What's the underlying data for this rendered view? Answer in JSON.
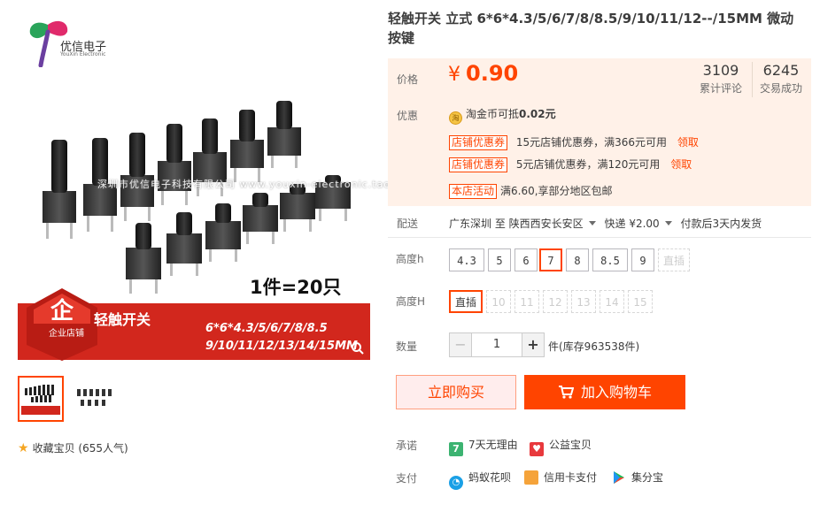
{
  "store": {
    "logo_text": "优信电子",
    "logo_sub": "YouXin Electronic"
  },
  "gallery": {
    "watermark": "深圳市优信电子科技有限公司  www.youxin-electronic.taobao.com",
    "qty_label": "1件=20只",
    "banner": {
      "badge_label": "企业店铺",
      "title": "轻触开关",
      "specs_line1": "6*6*4.3/5/6/7/8/8.5",
      "specs_line2": "9/10/11/12/13/14/15MM"
    },
    "thumbs": [
      "thumb-1",
      "thumb-2"
    ],
    "favorite": "收藏宝贝",
    "favorite_count": "(655人气)"
  },
  "product": {
    "title": "轻触开关 立式 6*6*4.3/5/6/7/8/8.5/9/10/11/12--/15MM 微动 按键",
    "price_label": "价格",
    "currency": "¥",
    "price": "0.90",
    "reviews_count": "3109",
    "reviews_label": "累计评论",
    "sales_count": "6245",
    "sales_label": "交易成功",
    "promo_label": "优惠",
    "coin_text": "淘金币可抵",
    "coin_value": "0.02元",
    "coupons": [
      {
        "tag": "店铺优惠券",
        "text": "15元店铺优惠券，满366元可用",
        "link": "领取"
      },
      {
        "tag": "店铺优惠券",
        "text": "5元店铺优惠券，满120元可用",
        "link": "领取"
      }
    ],
    "activity_tag": "本店活动",
    "activity_text": "满6.60,享部分地区包邮",
    "ship_label": "配送",
    "ship_from": "广东深圳 至",
    "ship_to": "陕西西安长安区",
    "ship_method": "快递 ¥2.00",
    "ship_time": "付款后3天内发货",
    "height_h_label": "高度h",
    "height_h_options": [
      "4.3",
      "5",
      "6",
      "7",
      "8",
      "8.5",
      "9",
      "直插"
    ],
    "height_h_selected": "7",
    "height_H_label": "高度H",
    "height_H_options": [
      "直插",
      "10",
      "11",
      "12",
      "13",
      "14",
      "15"
    ],
    "height_H_selected": "直插",
    "qty_label": "数量",
    "qty_value": "1",
    "qty_minus": "−",
    "qty_plus": "+",
    "stock": "件(库存963538件)",
    "buy_now": "立即购买",
    "add_cart": "加入购物车",
    "promise_label": "承诺",
    "promise_1": "7天无理由",
    "promise_2": "公益宝贝",
    "pay_label": "支付",
    "pay_1": "蚂蚁花呗",
    "pay_2": "信用卡支付",
    "pay_3": "集分宝"
  },
  "colors": {
    "accent": "#ff4400",
    "price_bg": "#fff1e8",
    "banner_red": "#d2271d"
  },
  "icons": [
    "logo-icon",
    "coin-icon",
    "caret-down-icon",
    "cart-icon",
    "seven-day-icon",
    "charity-icon",
    "huabei-icon",
    "credit-card-icon",
    "jifenbao-icon",
    "star-icon",
    "search-icon"
  ]
}
